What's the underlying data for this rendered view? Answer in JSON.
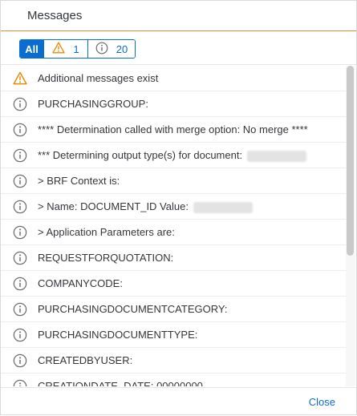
{
  "dialog": {
    "title": "Messages"
  },
  "filters": {
    "all_label": "All",
    "warning_count": "1",
    "info_count": "20"
  },
  "messages": [
    {
      "type": "warning",
      "text": "Additional messages exist"
    },
    {
      "type": "info",
      "text": "PURCHASINGGROUP:"
    },
    {
      "type": "info",
      "text": "**** Determination called with merge option: No merge ****"
    },
    {
      "type": "info",
      "text": "*** Determining output type(s) for document:"
    },
    {
      "type": "info",
      "text": "> BRF Context is:"
    },
    {
      "type": "info",
      "text": "> Name: DOCUMENT_ID Value:"
    },
    {
      "type": "info",
      "text": "> Application Parameters are:"
    },
    {
      "type": "info",
      "text": "REQUESTFORQUOTATION:"
    },
    {
      "type": "info",
      "text": "COMPANYCODE:"
    },
    {
      "type": "info",
      "text": "PURCHASINGDOCUMENTCATEGORY:"
    },
    {
      "type": "info",
      "text": "PURCHASINGDOCUMENTTYPE:"
    },
    {
      "type": "info",
      "text": "CREATEDBYUSER:"
    },
    {
      "type": "info",
      "text": "CREATIONDATE_DATE: 00000000"
    }
  ],
  "footer": {
    "close_label": "Close"
  },
  "colors": {
    "accent": "#0a6ed1",
    "warning": "#e78c07",
    "info": "#6a6d70",
    "header_line": "#e58e2a"
  },
  "icons": {
    "warning": "warning-triangle-icon",
    "info": "info-circle-icon"
  }
}
